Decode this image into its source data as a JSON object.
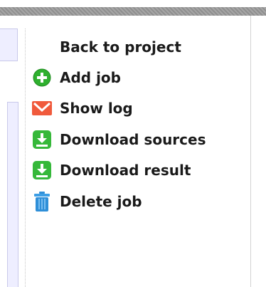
{
  "menu": {
    "items": [
      {
        "label": "Back to project",
        "icon": "none"
      },
      {
        "label": "Add job",
        "icon": "plus-circle-icon"
      },
      {
        "label": "Show log",
        "icon": "envelope-icon"
      },
      {
        "label": "Download sources",
        "icon": "download-icon"
      },
      {
        "label": "Download result",
        "icon": "download-icon"
      },
      {
        "label": "Delete job",
        "icon": "trash-icon"
      }
    ]
  },
  "colors": {
    "add": "#2fb02f",
    "log": "#f05a3c",
    "download": "#36b83a",
    "delete": "#2f8fd8",
    "text": "#1a1a1a"
  }
}
